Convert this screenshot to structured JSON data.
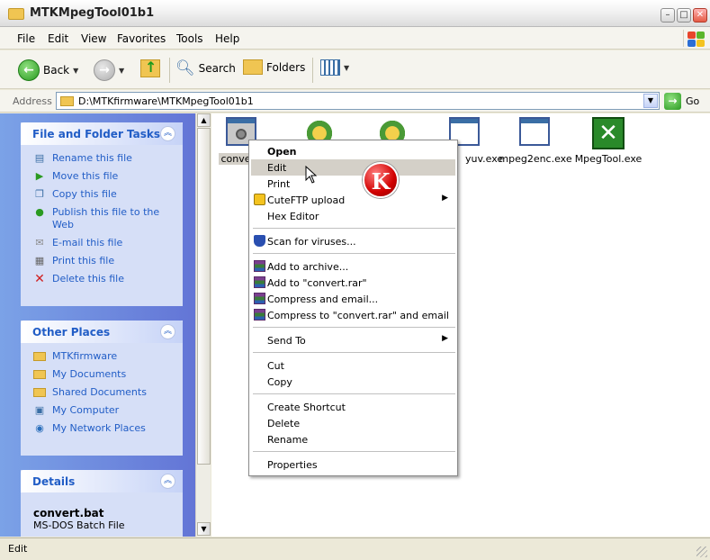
{
  "window": {
    "title": "MTKMpegTool01b1",
    "controls": [
      "minimize",
      "maximize",
      "close"
    ]
  },
  "menubar": {
    "items": [
      "File",
      "Edit",
      "View",
      "Favorites",
      "Tools",
      "Help"
    ]
  },
  "toolbar": {
    "back_label": "Back",
    "search_label": "Search",
    "folders_label": "Folders"
  },
  "address": {
    "label": "Address",
    "value": "D:\\MTKfirmware\\MTKMpegTool01b1",
    "go_label": "Go"
  },
  "left_pane": {
    "file_tasks": {
      "title": "File and Folder Tasks",
      "items": [
        {
          "label": "Rename this file",
          "icon": "rename-icon"
        },
        {
          "label": "Move this file",
          "icon": "move-icon"
        },
        {
          "label": "Copy this file",
          "icon": "copy-icon"
        },
        {
          "label": "Publish this file to the Web",
          "icon": "publish-web-icon"
        },
        {
          "label": "E-mail this file",
          "icon": "email-icon"
        },
        {
          "label": "Print this file",
          "icon": "print-icon"
        },
        {
          "label": "Delete this file",
          "icon": "delete-icon"
        }
      ]
    },
    "other_places": {
      "title": "Other Places",
      "items": [
        {
          "label": "MTKfirmware",
          "icon": "folder-icon"
        },
        {
          "label": "My Documents",
          "icon": "my-documents-icon"
        },
        {
          "label": "Shared Documents",
          "icon": "shared-documents-icon"
        },
        {
          "label": "My Computer",
          "icon": "my-computer-icon"
        },
        {
          "label": "My Network Places",
          "icon": "network-places-icon"
        }
      ]
    },
    "details": {
      "title": "Details",
      "file_name": "convert.bat",
      "file_type": "MS-DOS Batch File"
    }
  },
  "files": [
    {
      "label": "conve",
      "icon": "batch-file-icon",
      "selected": true
    },
    {
      "label": "",
      "icon": "setup-app-icon"
    },
    {
      "label": "",
      "icon": "setup-app-icon"
    },
    {
      "label": "yuv.exe",
      "icon": "exe-window-icon"
    },
    {
      "label": "mpeg2enc.exe",
      "icon": "exe-window-icon"
    },
    {
      "label": "MpegTool.exe",
      "icon": "mpegtool-app-icon"
    }
  ],
  "context_menu": {
    "items": {
      "open": "Open",
      "edit": "Edit",
      "print": "Print",
      "cuteftp": "CuteFTP upload",
      "hex_editor": "Hex Editor",
      "scan": "Scan for viruses...",
      "add_archive": "Add to archive...",
      "add_rar": "Add to \"convert.rar\"",
      "compress_email": "Compress and email...",
      "compress_rar_email": "Compress to \"convert.rar\" and email",
      "send_to": "Send To",
      "cut": "Cut",
      "copy": "Copy",
      "create_shortcut": "Create Shortcut",
      "delete": "Delete",
      "rename": "Rename",
      "properties": "Properties"
    },
    "highlighted": "Edit"
  },
  "badge": {
    "letter": "K"
  },
  "status_bar": {
    "text": "Edit"
  },
  "colors": {
    "task_link": "#215dc6",
    "left_pane_gradient": [
      "#7ba2e7",
      "#6375d6"
    ],
    "menu_highlight": "#d4d0c8"
  }
}
